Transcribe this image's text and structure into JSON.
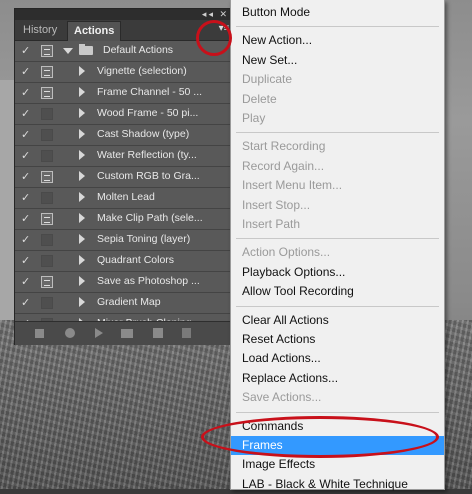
{
  "panel": {
    "tabs": [
      {
        "label": "History",
        "active": false
      },
      {
        "label": "Actions",
        "active": true
      }
    ],
    "strip_icons": "◂◂ ✕",
    "menu_icon": "▾≡",
    "action_set": {
      "label": "Default Actions",
      "checked": true,
      "expanded": true
    },
    "actions": [
      {
        "label": "Vignette (selection)",
        "checked": true,
        "dialog": true
      },
      {
        "label": "Frame Channel - 50 ...",
        "checked": true,
        "dialog": true
      },
      {
        "label": "Wood Frame - 50 pi...",
        "checked": true,
        "dialog": false
      },
      {
        "label": "Cast Shadow (type)",
        "checked": true,
        "dialog": false
      },
      {
        "label": "Water Reflection (ty...",
        "checked": true,
        "dialog": false
      },
      {
        "label": "Custom RGB to Gra...",
        "checked": true,
        "dialog": true
      },
      {
        "label": "Molten Lead",
        "checked": true,
        "dialog": false
      },
      {
        "label": "Make Clip Path (sele...",
        "checked": true,
        "dialog": true
      },
      {
        "label": "Sepia Toning (layer)",
        "checked": true,
        "dialog": false
      },
      {
        "label": "Quadrant Colors",
        "checked": true,
        "dialog": false
      },
      {
        "label": "Save as Photoshop ...",
        "checked": true,
        "dialog": true
      },
      {
        "label": "Gradient Map",
        "checked": true,
        "dialog": false
      },
      {
        "label": "Mixer Brush Cloning...",
        "checked": true,
        "dialog": false
      }
    ],
    "bottom_icons": [
      "stop-icon",
      "record-icon",
      "play-icon",
      "new-set-icon",
      "new-action-icon",
      "trash-icon"
    ]
  },
  "menu": {
    "items": [
      {
        "label": "Button Mode",
        "disabled": false
      },
      {
        "sep": true
      },
      {
        "label": "New Action...",
        "disabled": false
      },
      {
        "label": "New Set...",
        "disabled": false
      },
      {
        "label": "Duplicate",
        "disabled": true
      },
      {
        "label": "Delete",
        "disabled": true
      },
      {
        "label": "Play",
        "disabled": true
      },
      {
        "sep": true
      },
      {
        "label": "Start Recording",
        "disabled": true
      },
      {
        "label": "Record Again...",
        "disabled": true
      },
      {
        "label": "Insert Menu Item...",
        "disabled": true
      },
      {
        "label": "Insert Stop...",
        "disabled": true
      },
      {
        "label": "Insert Path",
        "disabled": true
      },
      {
        "sep": true
      },
      {
        "label": "Action Options...",
        "disabled": true
      },
      {
        "label": "Playback Options...",
        "disabled": false
      },
      {
        "label": "Allow Tool Recording",
        "disabled": false
      },
      {
        "sep": true
      },
      {
        "label": "Clear All Actions",
        "disabled": false
      },
      {
        "label": "Reset Actions",
        "disabled": false
      },
      {
        "label": "Load Actions...",
        "disabled": false
      },
      {
        "label": "Replace Actions...",
        "disabled": false
      },
      {
        "label": "Save Actions...",
        "disabled": true
      },
      {
        "sep": true
      },
      {
        "label": "Commands",
        "disabled": false
      },
      {
        "label": "Frames",
        "disabled": false,
        "highlighted": true
      },
      {
        "label": "Image Effects",
        "disabled": false
      },
      {
        "label": "LAB - Black & White Technique",
        "disabled": false
      }
    ]
  },
  "colors": {
    "highlight": "#3399ff",
    "annotation": "#c8101a",
    "panel_bg": "#535353"
  }
}
